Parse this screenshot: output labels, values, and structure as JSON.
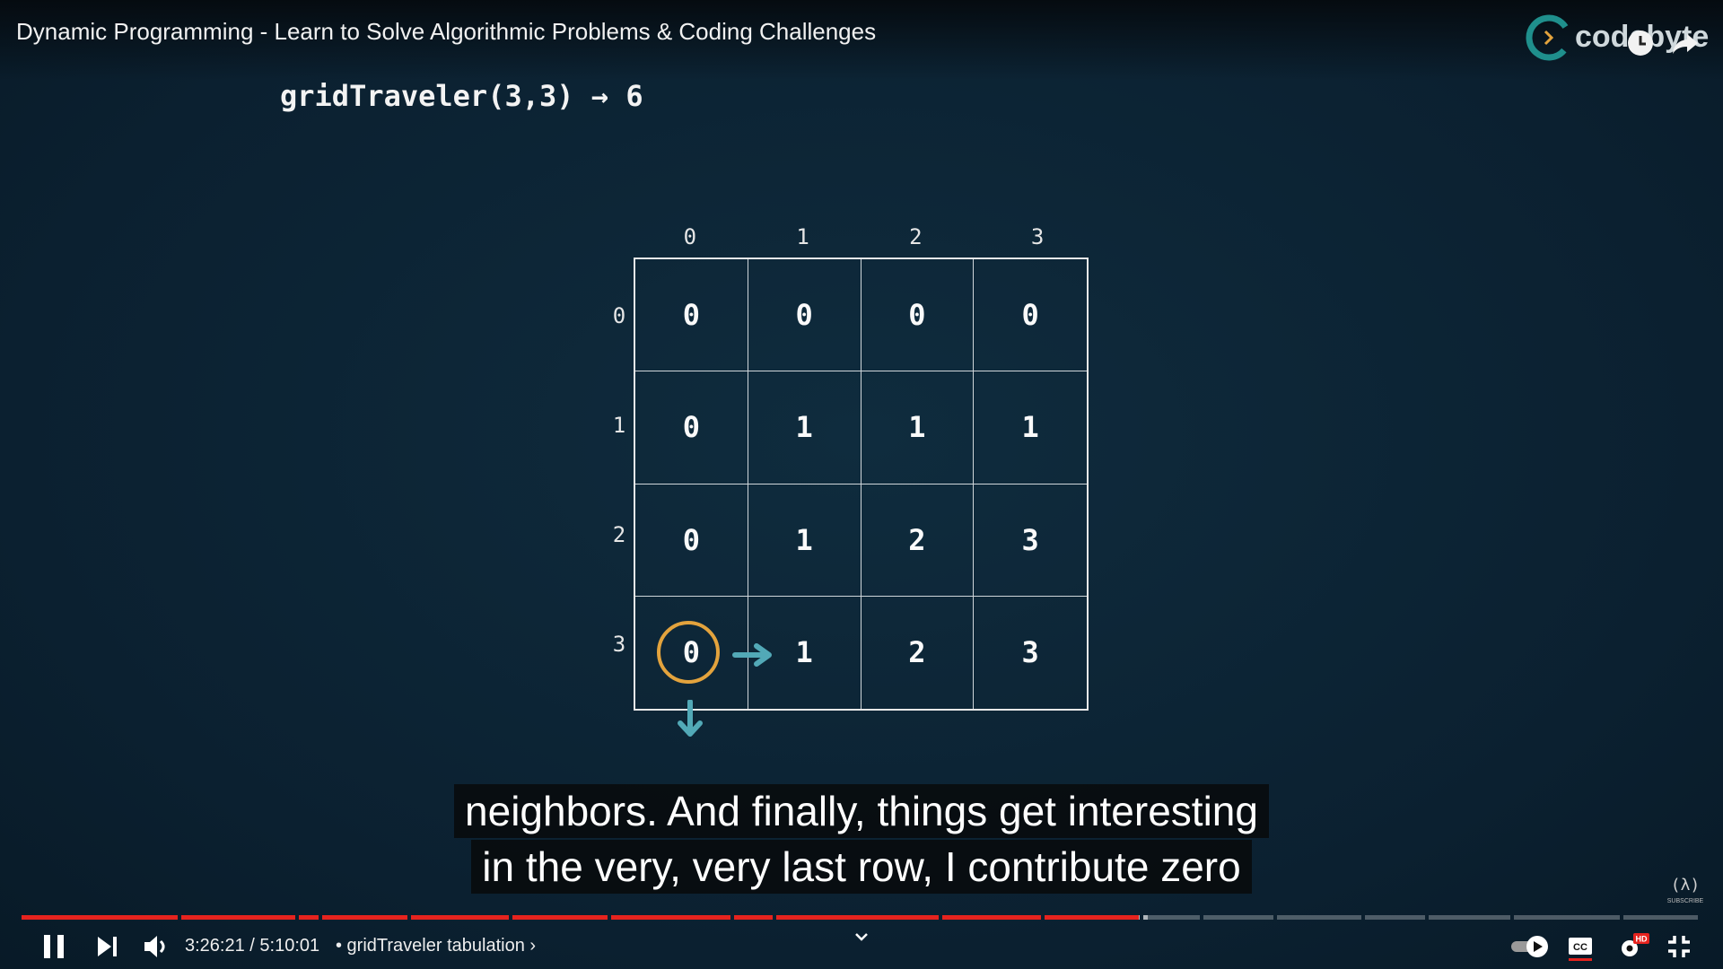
{
  "video": {
    "title": "Dynamic Programming - Learn to Solve Algorithmic Problems & Coding Challenges",
    "logo_text": "codebyte",
    "top_icons": [
      "clock-icon",
      "share-icon"
    ]
  },
  "slide": {
    "headline": "gridTraveler(3,3) → 6",
    "column_headers": [
      "0",
      "1",
      "2",
      "3"
    ],
    "row_headers": [
      "0",
      "1",
      "2",
      "3"
    ],
    "table": [
      [
        "0",
        "0",
        "0",
        "0"
      ],
      [
        "0",
        "1",
        "1",
        "1"
      ],
      [
        "0",
        "1",
        "2",
        "3"
      ],
      [
        "0",
        "1",
        "2",
        "3"
      ]
    ],
    "highlight": {
      "row": 3,
      "col": 0,
      "color": "#e3a33d"
    },
    "arrow_color": "#52a9b7"
  },
  "captions": {
    "line1": "neighbors. And finally, things get interesting",
    "line2": "in the very, very last row, I contribute zero"
  },
  "player": {
    "current_time": "3:26:21",
    "duration": "5:10:01",
    "time_display": "3:26:21 / 5:10:01",
    "chapter": "• gridTraveler tabulation ›",
    "progress_fraction": 0.665,
    "progress_color": "#e6231e",
    "controls": [
      "pause-icon",
      "next-icon",
      "volume-icon",
      "chevron-down-icon",
      "autoplay-toggle",
      "captions-icon",
      "settings-icon",
      "exit-fullscreen-icon"
    ],
    "settings_badge": "HD",
    "channel_watermark": "SUBSCRIBE"
  }
}
